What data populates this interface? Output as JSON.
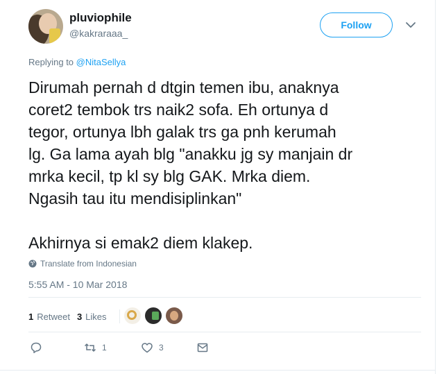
{
  "user": {
    "display_name": "pluviophile",
    "handle": "@kakraraaa_"
  },
  "header": {
    "follow_label": "Follow",
    "menu_icon": "chevron-down-icon"
  },
  "reply": {
    "prefix": "Replying to",
    "mention": "@NitaSellya"
  },
  "tweet": {
    "text": "Dirumah pernah d dtgin temen ibu, anaknya\ncoret2 tembok trs naik2 sofa. Eh ortunya d\ntegor, ortunya lbh galak trs ga pnh kerumah\nlg. Ga lama ayah blg \"anakku jg sy manjain dr\nmrka kecil, tp kl sy blg GAK. Mrka diem.\nNgasih tau itu mendisiplinkan\"\n\nAkhirnya si emak2 diem klakep.",
    "translate_label": "Translate from Indonesian",
    "timestamp": "5:55 AM - 10 Mar 2018"
  },
  "stats": {
    "retweets_count": "1",
    "retweets_label": "Retweet",
    "likes_count": "3",
    "likes_label": "Likes"
  },
  "actions": {
    "reply_icon": "reply-icon",
    "retweet_count": "1",
    "like_count": "3",
    "message_icon": "message-icon"
  },
  "colors": {
    "accent": "#1da1f2",
    "secondary_text": "#657786",
    "primary_text": "#14171a",
    "divider": "#e6ecf0"
  }
}
